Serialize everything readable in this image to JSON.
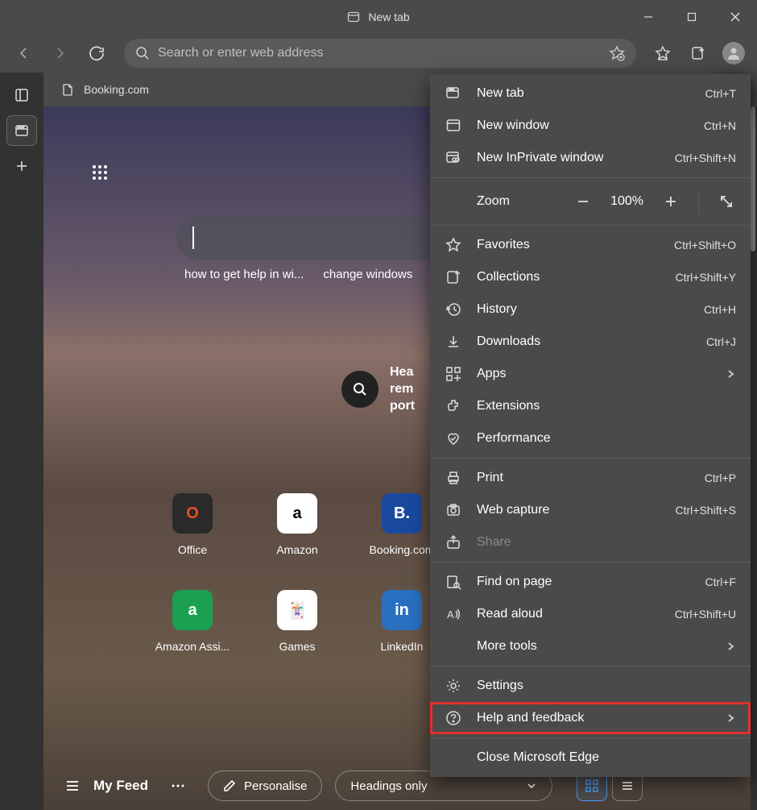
{
  "window": {
    "title": "New tab"
  },
  "toolbar": {
    "search_placeholder": "Search or enter web address"
  },
  "tab": {
    "label": "Booking.com"
  },
  "ntp": {
    "suggestions": [
      "how to get help in wi...",
      "change windows"
    ],
    "news": {
      "line1": "Hea",
      "line2": "rem",
      "line3": "port"
    },
    "quick_links": [
      {
        "label": "Office",
        "letter": "O",
        "bg": "#2a2a2a",
        "fg": "#e85020"
      },
      {
        "label": "Amazon",
        "letter": "a",
        "bg": "#ffffff",
        "fg": "#000000"
      },
      {
        "label": "Booking.com",
        "letter": "B.",
        "bg": "#1a4aa0",
        "fg": "#ffffff"
      },
      {
        "label": "Amazon Assi...",
        "letter": "a",
        "bg": "#1aa050",
        "fg": "#ffffff"
      },
      {
        "label": "Games",
        "letter": "🃏",
        "bg": "#ffffff",
        "fg": "#000000"
      },
      {
        "label": "LinkedIn",
        "letter": "in",
        "bg": "#2a70c0",
        "fg": "#ffffff"
      }
    ],
    "feed": {
      "label": "My Feed",
      "personalise": "Personalise",
      "headings": "Headings only"
    }
  },
  "menu": {
    "items": [
      {
        "icon": "new-tab",
        "label": "New tab",
        "shortcut": "Ctrl+T"
      },
      {
        "icon": "new-window",
        "label": "New window",
        "shortcut": "Ctrl+N"
      },
      {
        "icon": "inprivate",
        "label": "New InPrivate window",
        "shortcut": "Ctrl+Shift+N"
      }
    ],
    "zoom": {
      "label": "Zoom",
      "value": "100%"
    },
    "items2": [
      {
        "icon": "star",
        "label": "Favorites",
        "shortcut": "Ctrl+Shift+O"
      },
      {
        "icon": "collections",
        "label": "Collections",
        "shortcut": "Ctrl+Shift+Y"
      },
      {
        "icon": "history",
        "label": "History",
        "shortcut": "Ctrl+H"
      },
      {
        "icon": "download",
        "label": "Downloads",
        "shortcut": "Ctrl+J"
      },
      {
        "icon": "apps",
        "label": "Apps",
        "arrow": true
      },
      {
        "icon": "extensions",
        "label": "Extensions"
      },
      {
        "icon": "performance",
        "label": "Performance"
      }
    ],
    "items3": [
      {
        "icon": "print",
        "label": "Print",
        "shortcut": "Ctrl+P"
      },
      {
        "icon": "capture",
        "label": "Web capture",
        "shortcut": "Ctrl+Shift+S"
      },
      {
        "icon": "share",
        "label": "Share",
        "disabled": true
      }
    ],
    "items4": [
      {
        "icon": "find",
        "label": "Find on page",
        "shortcut": "Ctrl+F"
      },
      {
        "icon": "read-aloud",
        "label": "Read aloud",
        "shortcut": "Ctrl+Shift+U"
      },
      {
        "icon": "more-tools",
        "label": "More tools",
        "arrow": true
      }
    ],
    "items5": [
      {
        "icon": "settings",
        "label": "Settings"
      },
      {
        "icon": "help",
        "label": "Help and feedback",
        "arrow": true,
        "highlighted": true
      }
    ],
    "items6": [
      {
        "icon": "",
        "label": "Close Microsoft Edge"
      }
    ]
  }
}
